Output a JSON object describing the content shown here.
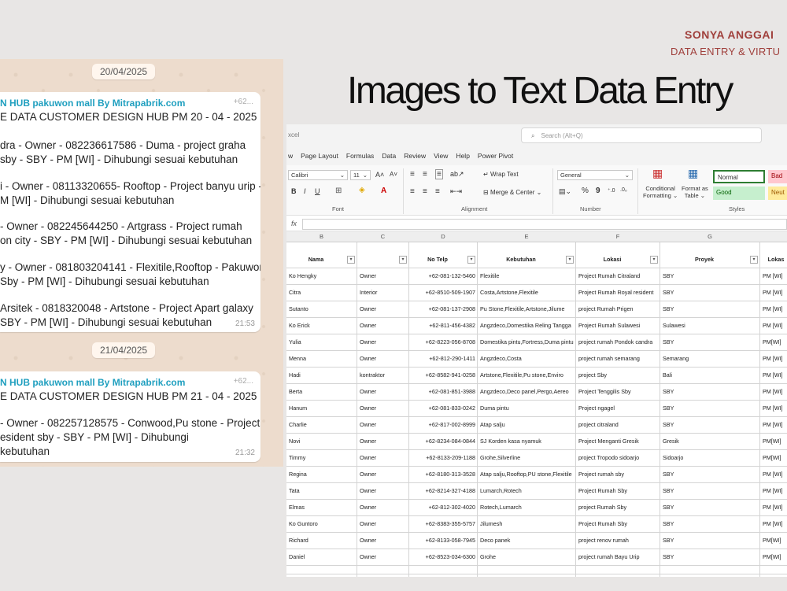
{
  "header": {
    "brand_name": "SONYA ANGGAI",
    "brand_sub": "DATA ENTRY & VIRTU",
    "title": "Images to Text Data Entry"
  },
  "chat": {
    "dates": [
      "20/04/2025",
      "21/04/2025"
    ],
    "messages": [
      {
        "sender": "N HUB pakuwon mall By Mitrapabrik.com",
        "phone": "+62...",
        "lines": [
          "E DATA CUSTOMER DESIGN HUB  PM 20 - 04 - 2025 :",
          "",
          "dra - Owner - 082236617586 - Duma - project graha",
          "sby - SBY - PM [WI] - Dihubungi sesuai kebutuhan",
          "",
          "i - Owner - 08113320655- Rooftop - Project banyu urip -",
          "M [WI] - Dihubungi sesuai kebutuhan",
          "",
          "- Owner - 082245644250 - Artgrass - Project rumah",
          "on city - SBY - PM [WI] - Dihubungi sesuai kebutuhan",
          "",
          "y - Owner - 081803204141 - Flexitile,Rooftop - Pakuwon",
          "Sby - PM [WI] - Dihubungi sesuai kebutuhan",
          "",
          "Arsitek - 0818320048 - Artstone - Project Apart galaxy",
          "SBY - PM [WI] - Dihubungi sesuai kebutuhan"
        ],
        "time": "21:53"
      },
      {
        "sender": "N HUB pakuwon mall By Mitrapabrik.com",
        "phone": "+62...",
        "lines": [
          "E DATA CUSTOMER DESIGN HUB  PM 21 - 04 - 2025 :",
          "",
          "- Owner - 082257128575 - Conwood,Pu stone - Project",
          "esident sby - SBY - PM [WI] - Dihubungi",
          "kebutuhan"
        ],
        "time": "21:32"
      }
    ]
  },
  "excel": {
    "app_name": "xcel",
    "search_placeholder": "Search (Alt+Q)",
    "menu": [
      "w",
      "Page Layout",
      "Formulas",
      "Data",
      "Review",
      "View",
      "Help",
      "Power Pivot"
    ],
    "ribbon": {
      "font_name": "Calibri",
      "font_size": "11",
      "wrap_text": "Wrap Text",
      "merge_center": "Merge & Center",
      "number_format": "General",
      "conditional": "Conditional",
      "formatting": "Formatting",
      "format_as": "Format as",
      "table": "Table",
      "groups": [
        "Font",
        "Alignment",
        "Number",
        "Styles"
      ],
      "styles": [
        "Normal",
        "Bad",
        "Good",
        "Neut"
      ]
    },
    "fx_label": "fx",
    "columns": [
      "B",
      "C",
      "D",
      "E",
      "F",
      "G"
    ],
    "headers": [
      "Nama",
      "",
      "No Telp",
      "Kebutuhan",
      "Lokasi",
      "Proyek",
      "Lokas"
    ],
    "rows": [
      [
        "Ko Hengky",
        "Owner",
        "+62-081-132-5460",
        "Flexitile",
        "Project Rumah Citraland",
        "SBY",
        "PM [WI]"
      ],
      [
        "Citra",
        "Interior",
        "+62-8510-509-1907",
        "Costa,Artstone,Flexitile",
        "Project Rumah Royal resident",
        "SBY",
        "PM [WI]"
      ],
      [
        "Sutanto",
        "Owner",
        "+62-081-137-2908",
        "Pu Stone,Flexitile,Artstone,Jilume",
        "project Rumah Prigen",
        "SBY",
        "PM [WI]"
      ],
      [
        "Ko Erick",
        "Owner",
        "+62-811-456-4382",
        "Angzdeco,Domestika Reling Tangga",
        "Project Rumah Sulawesi",
        "Sulawesi",
        "PM [WI]"
      ],
      [
        "Yulia",
        "Owner",
        "+62-8223-056-8708",
        "Domestika pintu,Fortress,Duma pintu",
        "project rumah Pondok candra",
        "SBY",
        "PM[WI]"
      ],
      [
        "Menna",
        "Owner",
        "+62-812-290-1411",
        "Angzdeco,Costa",
        "project rumah semarang",
        "Semarang",
        "PM [WI]"
      ],
      [
        "Hadi",
        "kontraktor",
        "+62-8582-941-0258",
        "Artstone,Flexitile,Pu stone,Enviro",
        "project Sby",
        "Bali",
        "PM [WI]"
      ],
      [
        "Berta",
        "Owner",
        "+62-081-851-3988",
        "Angzdeco,Deco panel,Pergo,Aereo",
        "Project Tenggilis Sby",
        "SBY",
        "PM [WI]"
      ],
      [
        "Hanum",
        "Owner",
        "+62-081-833-0242",
        "Duma pintu",
        "Project ngagel",
        "SBY",
        "PM [WI]"
      ],
      [
        "Charlie",
        "Owner",
        "+62-817-002-8999",
        "Atap salju",
        "project citraland",
        "SBY",
        "PM [WI]"
      ],
      [
        "Novi",
        "Owner",
        "+62-8234-084-0844",
        "SJ Korden kasa nyamuk",
        "Project Menganti Gresik",
        "Gresik",
        "PM[WI]"
      ],
      [
        "Timmy",
        "Owner",
        "+62-8133-209-1188",
        "Grohe,Silverline",
        "project Tropodo sidoarjo",
        "Sidoarjo",
        "PM[WI]"
      ],
      [
        "Regina",
        "Owner",
        "+62-8180-313-3528",
        "Atap salju,Rooftop,PU stone,Flexitile",
        "Project rumah sby",
        "SBY",
        "PM [WI]"
      ],
      [
        "Tata",
        "Owner",
        "+62-8214-327-4188",
        "Lumarch,Rotech",
        "Project Rumah Sby",
        "SBY",
        "PM [WI]"
      ],
      [
        "Elmas",
        "Owner",
        "+62-812-302-4020",
        "Rotech,Lumarch",
        "project Rumah Sby",
        "SBY",
        "PM [WI]"
      ],
      [
        "Ko Guntoro",
        "Owner",
        "+62-8383-355-5757",
        "Jilumesh",
        "Project Rumah Sby",
        "SBY",
        "PM [WI]"
      ],
      [
        "Richard",
        "Owner",
        "+62-8133-058-7945",
        "Deco panek",
        "project renov rumah",
        "SBY",
        "PM[WI]"
      ],
      [
        "Daniel",
        "Owner",
        "+62-8523-034-6300",
        "Grohe",
        "project rumah Bayu Urip",
        "SBY",
        "PM[WI]"
      ]
    ]
  }
}
